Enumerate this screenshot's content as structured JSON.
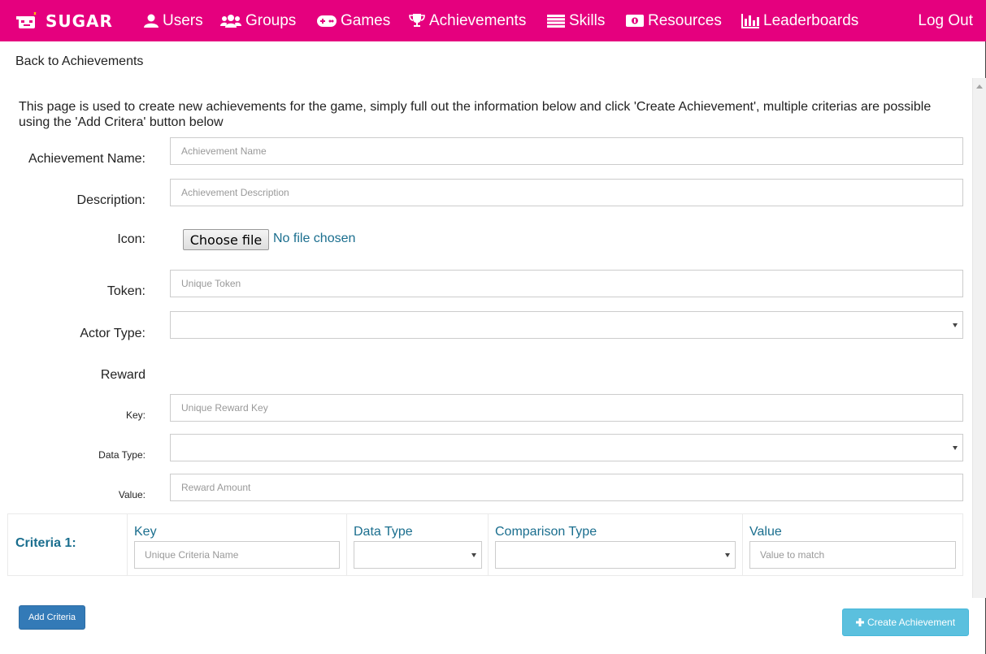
{
  "nav": {
    "brand": "SUGAR",
    "items": [
      {
        "label": "Users",
        "icon": "user-icon"
      },
      {
        "label": "Groups",
        "icon": "groups-icon"
      },
      {
        "label": "Games",
        "icon": "gamepad-icon"
      },
      {
        "label": "Achievements",
        "icon": "trophy-icon"
      },
      {
        "label": "Skills",
        "icon": "list-icon"
      },
      {
        "label": "Resources",
        "icon": "money-icon"
      },
      {
        "label": "Leaderboards",
        "icon": "bar-chart-icon"
      }
    ],
    "logout": "Log Out"
  },
  "back_link": "Back to Achievements",
  "intro": "This page is used to create new achievements for the game, simply full out the information below and click 'Create Achievement', multiple criterias are possible using the 'Add Critera' button below",
  "form": {
    "name_label": "Achievement Name:",
    "name_placeholder": "Achievement Name",
    "desc_label": "Description:",
    "desc_placeholder": "Achievement Description",
    "icon_label": "Icon:",
    "file_button": "Choose file",
    "file_status": "No file chosen",
    "token_label": "Token:",
    "token_placeholder": "Unique Token",
    "actor_label": "Actor Type:",
    "reward_heading": "Reward",
    "key_label": "Key:",
    "key_placeholder": "Unique Reward Key",
    "datatype_label": "Data Type:",
    "value_label": "Value:",
    "value_placeholder": "Reward Amount"
  },
  "criteria": {
    "title": "Criteria 1:",
    "key_header": "Key",
    "key_placeholder": "Unique Criteria Name",
    "datatype_header": "Data Type",
    "comparison_header": "Comparison Type",
    "value_header": "Value",
    "value_placeholder": "Value to match"
  },
  "buttons": {
    "add_criteria": "Add Criteria",
    "create_achievement": "Create Achievement"
  },
  "colors": {
    "navbar": "#e5007e",
    "link_blue": "#1a6e8e",
    "primary": "#337ab7",
    "info": "#5bc0de"
  }
}
